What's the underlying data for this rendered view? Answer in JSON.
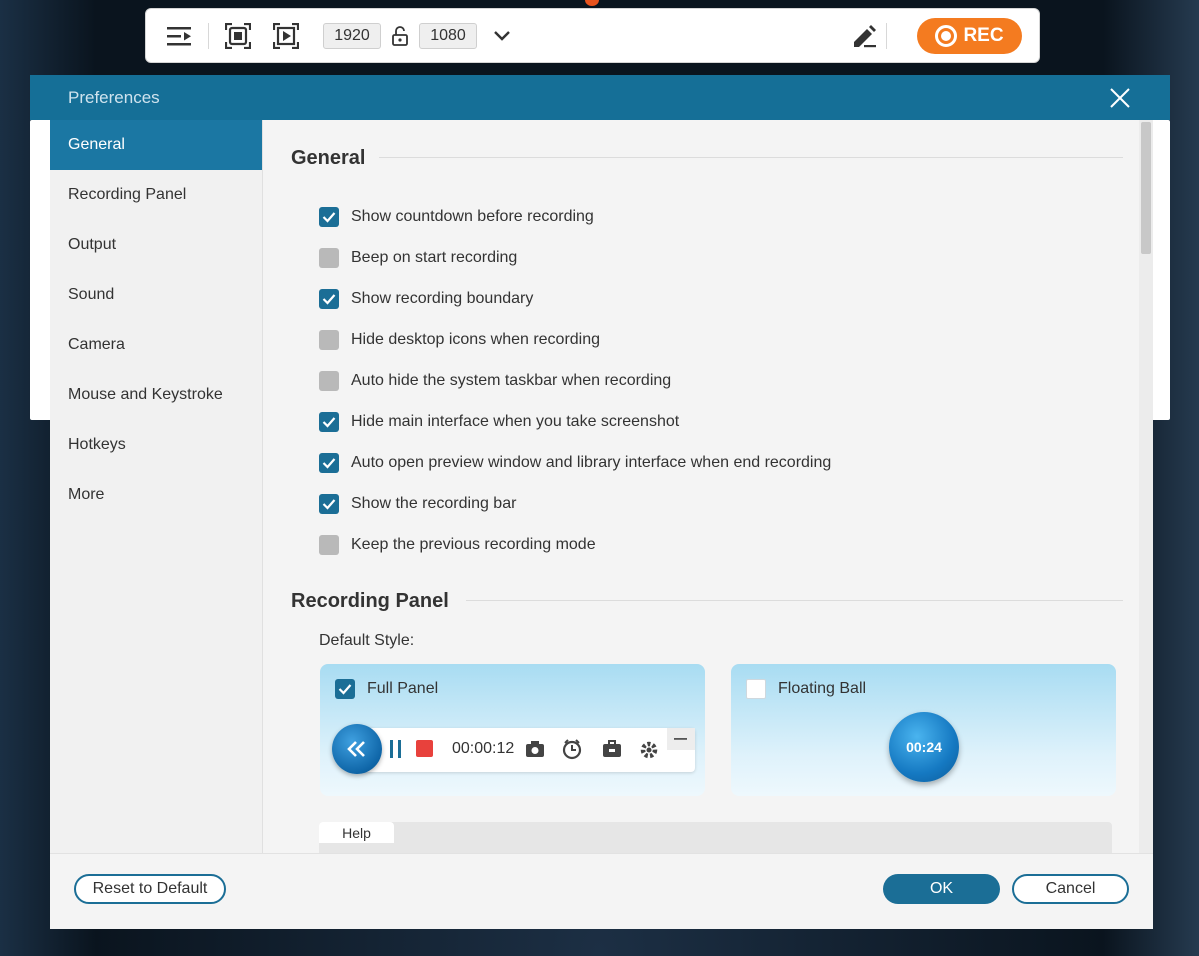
{
  "topbar": {
    "width_value": "1920",
    "height_value": "1080",
    "rec_label": "REC"
  },
  "dialog": {
    "title": "Preferences"
  },
  "sidebar": {
    "items": [
      {
        "label": "General",
        "active": true
      },
      {
        "label": "Recording Panel",
        "active": false
      },
      {
        "label": "Output",
        "active": false
      },
      {
        "label": "Sound",
        "active": false
      },
      {
        "label": "Camera",
        "active": false
      },
      {
        "label": "Mouse and Keystroke",
        "active": false
      },
      {
        "label": "Hotkeys",
        "active": false
      },
      {
        "label": "More",
        "active": false
      }
    ]
  },
  "general": {
    "heading": "General",
    "options": [
      {
        "label": "Show countdown before recording",
        "checked": true
      },
      {
        "label": "Beep on start recording",
        "checked": false
      },
      {
        "label": "Show recording boundary",
        "checked": true
      },
      {
        "label": "Hide desktop icons when recording",
        "checked": false
      },
      {
        "label": "Auto hide the system taskbar when recording",
        "checked": false
      },
      {
        "label": "Hide main interface when you take screenshot",
        "checked": true
      },
      {
        "label": "Auto open preview window and library interface when end recording",
        "checked": true
      },
      {
        "label": "Show the recording bar",
        "checked": true
      },
      {
        "label": "Keep the previous recording mode",
        "checked": false
      }
    ]
  },
  "recording_panel": {
    "heading": "Recording Panel",
    "default_style_label": "Default Style:",
    "full_panel_label": "Full Panel",
    "full_panel_checked": true,
    "floating_ball_label": "Floating Ball",
    "floating_ball_checked": false,
    "full_panel_time": "00:00:12",
    "floating_ball_time": "00:24"
  },
  "help": {
    "tab_label": "Help"
  },
  "footer": {
    "reset_label": "Reset to Default",
    "ok_label": "OK",
    "cancel_label": "Cancel"
  },
  "colors": {
    "accent": "#1b6e96",
    "titlebar": "#156f97",
    "rec": "#f47b20"
  }
}
